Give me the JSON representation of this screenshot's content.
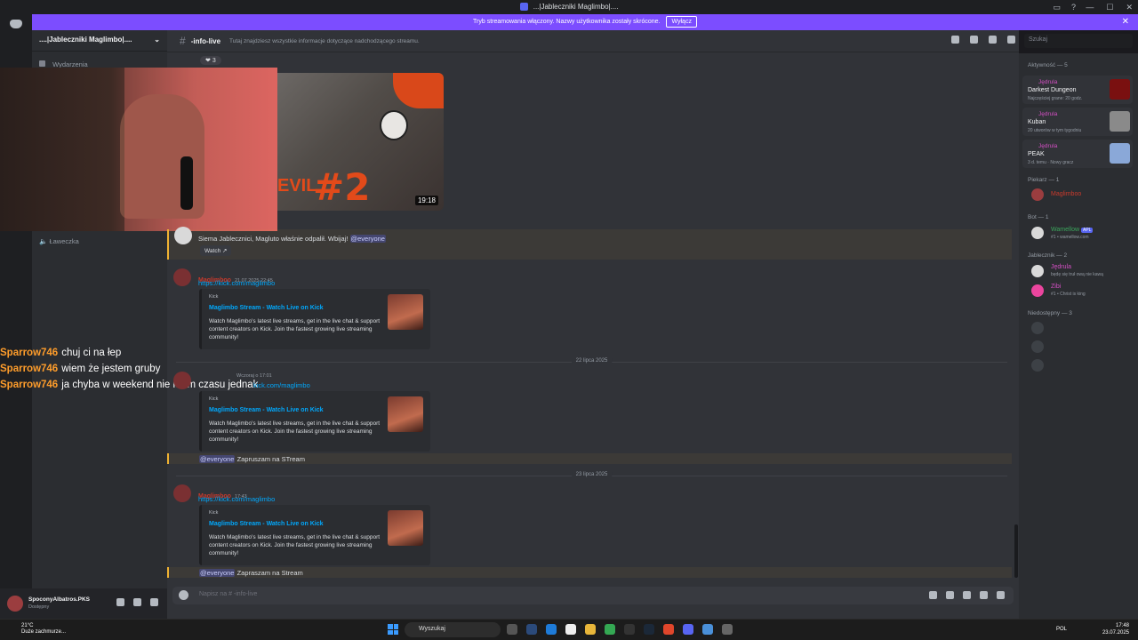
{
  "window": {
    "title": "...|Jableczniki Maglimbo|...."
  },
  "banner": {
    "text": "Tryb streamowania włączony. Nazwy użytkownika zostały skrócone.",
    "button": "Wyłącz"
  },
  "server": {
    "name": "....|Jableczniki Maglimbo|....",
    "events": "Wydarzenia",
    "voice_channel": "Ławeczka"
  },
  "channel": {
    "name": "-info-live",
    "topic": "Tutaj znajdziesz wszystkie informacje dotyczące nadchodzącego streamu.",
    "search_placeholder": "Szukaj"
  },
  "stream_chat": [
    {
      "user": "Sparrow746",
      "text": "chuj ci na łep"
    },
    {
      "user": "Sparrow746",
      "text": "wiem że jestem gruby"
    },
    {
      "user": "Sparrow746",
      "text": "ja chyba w weekend nie mam czasu jednak"
    }
  ],
  "messages": {
    "reaction_count": "3",
    "video_duration": "19:18",
    "video_overlay": "#2",
    "video_overlay_word": "EVIL",
    "wamellow_text_prefix": "Siema Jablecznici, Magluto właśnie odpalił. Wbijaj!",
    "wamellow_mention": "@everyone",
    "watch_button": "Watch",
    "m1": {
      "author": "Maglimboo",
      "time": "21.07.2025 22:45",
      "link": "https://kick.com/maglimbo"
    },
    "m2_link": "kick.com/maglimbo",
    "m2_time": "Wczoraj o 17:01",
    "m2_mention": "@everyone",
    "m2_text": "Zapruszam na STream",
    "m3": {
      "author": "Maglimboo",
      "time": "17:43",
      "link": "https://kick.com/maglimbo"
    },
    "m3_mention": "@everyone",
    "m3_text": "Zapraszam na Stream",
    "date1": "22 lipca 2025",
    "date2": "23 lipca 2025",
    "embed": {
      "provider": "Kick",
      "title": "Maglimbo Stream - Watch Live on Kick",
      "desc": "Watch Maglimbo's latest live streams, get in the live chat & support content creators on Kick. Join the fastest growing live streaming community!"
    }
  },
  "composer": {
    "placeholder": "Napisz na #",
    "channel": "-info-live"
  },
  "members": {
    "activity_header": "Aktywność — 5",
    "activities": [
      {
        "name": "Jędrula",
        "game": "Darkest Dungeon",
        "detail": "Najczęściej grane: 20 godz.",
        "color": "#7a1010"
      },
      {
        "name": "Jędrula",
        "game": "Kuban",
        "detail": "20 utworów w tym tygodniu",
        "color": "#8a8a8a"
      },
      {
        "name": "Jędrula",
        "game": "PEAK",
        "detail": "3 d. temu",
        "extra": "Nowy gracz",
        "color": "#8aa8d8"
      }
    ],
    "g_piekarz": "Piekarz — 1",
    "piekarz": "Maglimboo",
    "g_bot": "Bot — 1",
    "bot": "Wamellow",
    "bot_badge": "APL",
    "bot_status": "#1 • wamellow.com",
    "g_jablecznik": "Jablecznik — 2",
    "j1": "Jędrula",
    "j1_status": "będę się truł ową nie kawą",
    "j2": "Zibi",
    "j2_status": "#1 • Christ is king",
    "g_offline": "Niedostępny — 3"
  },
  "user_panel": {
    "name": "SpoconyAlbatros.PKS",
    "status": "Dostępny"
  },
  "taskbar": {
    "temp": "21°C",
    "weather": "Duże zachmurze...",
    "search": "Wyszukaj",
    "lang": "POL",
    "time": "17:48",
    "date": "23.07.2025"
  }
}
